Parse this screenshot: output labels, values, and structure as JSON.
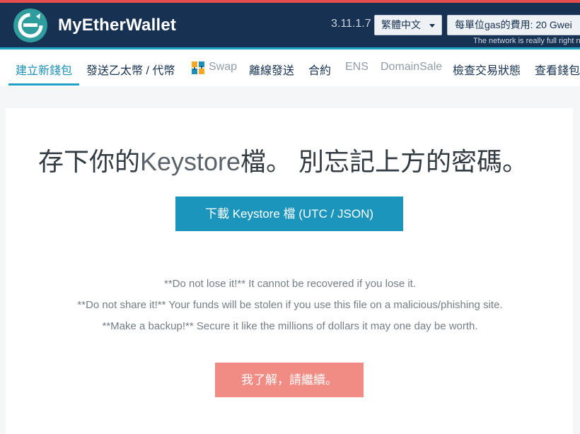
{
  "header": {
    "brand": "MyEtherWallet",
    "version": "3.11.1.7",
    "language": "繁體中文",
    "gas_price": "每單位gas的費用: 20 Gwei",
    "network_note": "The network is really full right now"
  },
  "nav": {
    "items": [
      {
        "label": "建立新錢包"
      },
      {
        "label": "發送乙太幣 / 代幣"
      },
      {
        "label": "Swap"
      },
      {
        "label": "離線發送"
      },
      {
        "label": "合約"
      },
      {
        "label": "ENS"
      },
      {
        "label": "DomainSale"
      },
      {
        "label": "檢查交易狀態"
      },
      {
        "label": "查看錢包"
      }
    ]
  },
  "main": {
    "title_part1": "存下你的",
    "title_keyword": "Keystore",
    "title_part2": "檔。 別忘記上方的密碼。",
    "download_button": "下載 Keystore 檔 (UTC / JSON)",
    "warnings": [
      "**Do not lose it!** It cannot be recovered if you lose it.",
      "**Do not share it!** Your funds will be stolen if you use this file on a malicious/phishing site.",
      "**Make a backup!** Secure it like the millions of dollars it may one day be worth."
    ],
    "continue_button": "我了解，請繼續。"
  },
  "colors": {
    "header_bg": "#163151",
    "accent": "#1ea1c5",
    "download_button": "#1c95bd",
    "continue_button": "#f08c84"
  }
}
